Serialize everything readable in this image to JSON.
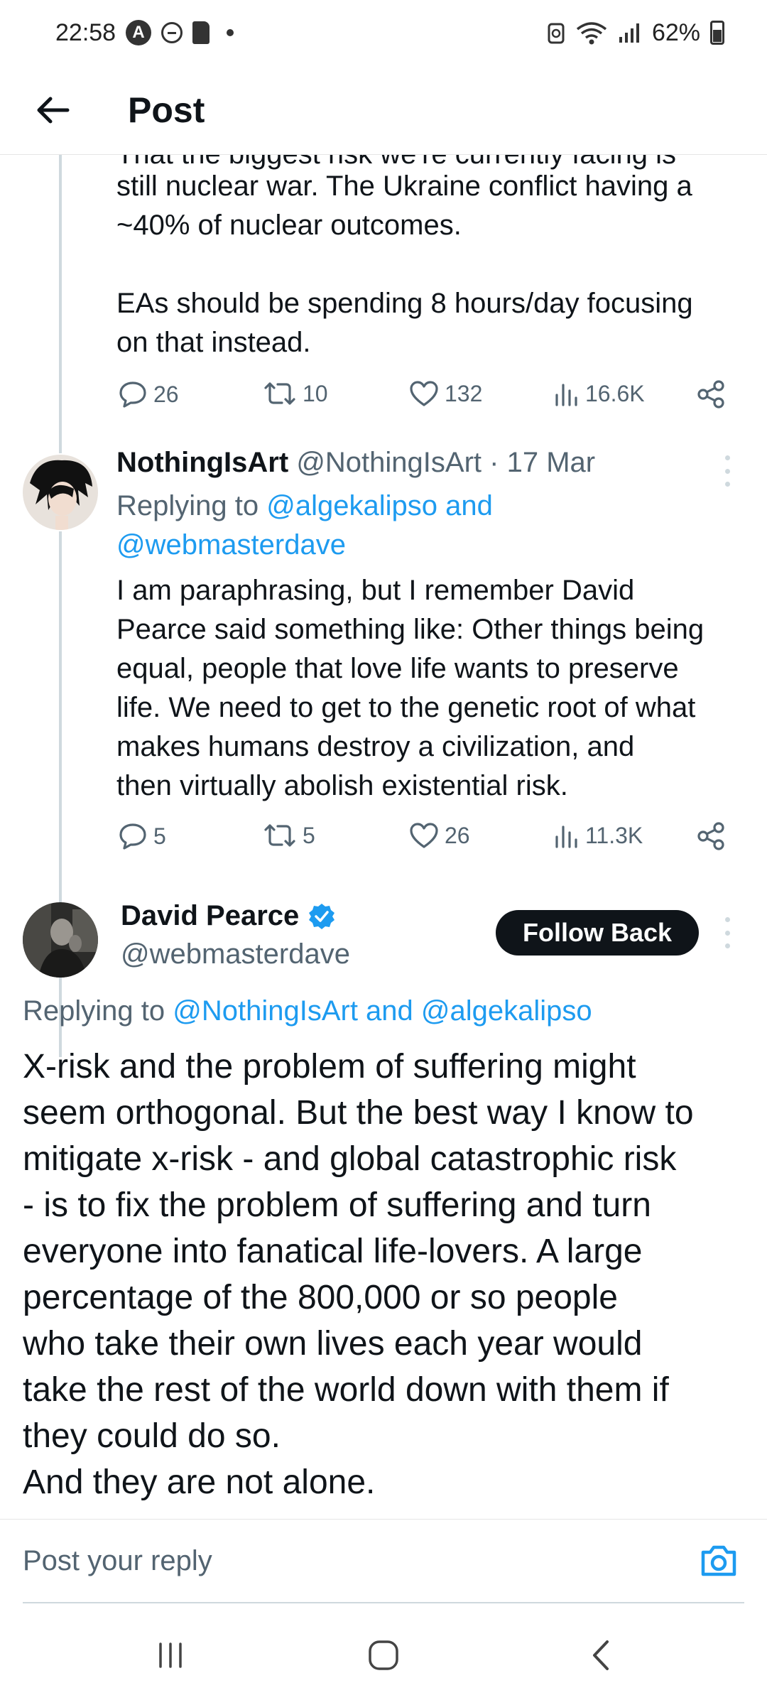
{
  "status_bar": {
    "time": "22:58",
    "badge_letter": "A",
    "battery": "62%",
    "icons": [
      "a-badge-icon",
      "dnd-icon",
      "sd-card-icon",
      "dot-icon",
      "saver-icon",
      "wifi-icon",
      "signal-icon",
      "battery-icon"
    ]
  },
  "top_bar": {
    "title": "Post",
    "back_icon": "arrow-left-icon"
  },
  "tweet1": {
    "text_cut": "That the biggest risk we're currently facing is",
    "text_lines": [
      "still nuclear war. The Ukraine conflict having a",
      "~40% of nuclear outcomes.",
      "",
      "EAs should be spending 8 hours/day focusing",
      "on that instead."
    ],
    "actions": {
      "replies": "26",
      "reposts": "10",
      "likes": "132",
      "views": "16.6K"
    }
  },
  "tweet2": {
    "name": "NothingIsArt",
    "handle": "@NothingIsArt",
    "dot": "·",
    "date": "17 Mar",
    "replying_prefix": "Replying to ",
    "replying_link1": "@algekalipso and",
    "replying_link2": "@webmasterdave",
    "text_lines": [
      "I am paraphrasing, but I remember David",
      "Pearce said something like: Other things being",
      "equal, people that love life wants to preserve",
      "life. We need to get to the genetic root of what",
      "makes humans destroy a civilization, and",
      "then virtually abolish existential risk."
    ],
    "actions": {
      "replies": "5",
      "reposts": "5",
      "likes": "26",
      "views": "11.3K"
    }
  },
  "main_post": {
    "name": "David Pearce",
    "handle": "@webmasterdave",
    "follow_label": "Follow Back",
    "replying_prefix": "Replying to ",
    "replying_link": "@NothingIsArt and @algekalipso",
    "text_lines": [
      "X-risk and the problem of suffering might",
      "seem orthogonal. But the best way I know to",
      "mitigate x-risk - and global catastrophic risk",
      "- is to fix the problem of suffering and turn",
      "everyone into fanatical life-lovers. A large",
      "percentage of the 800,000 or so people",
      "who take their own lives each year would",
      "take the rest of the world down with them if",
      "they could do so.",
      "And they are not alone."
    ]
  },
  "reply_bar": {
    "placeholder": "Post your reply",
    "camera_icon": "camera-icon"
  },
  "colors": {
    "accent": "#1d9bf0",
    "text": "#0f1419",
    "muted": "#536471",
    "thread": "#cfd9de"
  }
}
